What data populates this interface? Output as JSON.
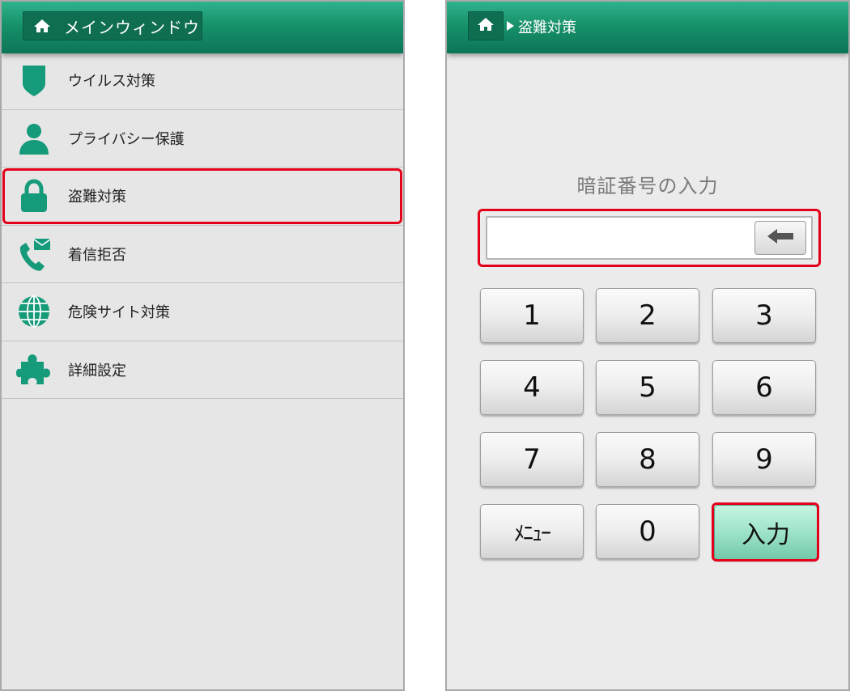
{
  "left": {
    "header_title": "メインウィンドウ",
    "menu": [
      {
        "label": "ウイルス対策",
        "icon": "shield-icon"
      },
      {
        "label": "プライバシー保護",
        "icon": "person-icon"
      },
      {
        "label": "盗難対策",
        "icon": "lock-icon",
        "selected": true
      },
      {
        "label": "着信拒否",
        "icon": "phone-mail-icon"
      },
      {
        "label": "危険サイト対策",
        "icon": "globe-icon"
      },
      {
        "label": "詳細設定",
        "icon": "puzzle-icon"
      }
    ]
  },
  "right": {
    "breadcrumb": "盗難対策",
    "pin_title": "暗証番号の入力",
    "pin_value": "",
    "keys": {
      "k1": "1",
      "k2": "2",
      "k3": "3",
      "k4": "4",
      "k5": "5",
      "k6": "6",
      "k7": "7",
      "k8": "8",
      "k9": "9",
      "menu": "ﾒﾆｭｰ",
      "k0": "0",
      "enter": "入力"
    }
  },
  "colors": {
    "header_green": "#17916c",
    "icon_green": "#159a7a",
    "highlight_red": "#e3001b",
    "enter_key": "#9de3c8"
  }
}
